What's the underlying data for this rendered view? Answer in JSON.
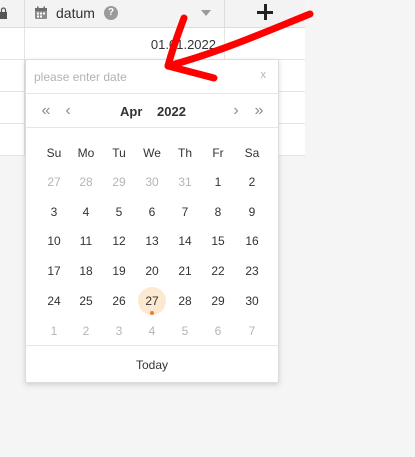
{
  "header": {
    "column_title": "datum",
    "help_glyph": "?",
    "icons": [
      "lock-icon",
      "calendar-icon",
      "help-icon",
      "dropdown-icon",
      "plus-icon"
    ]
  },
  "rows": [
    {
      "value": "01.01.2022"
    },
    {
      "value": ""
    },
    {
      "value": ""
    }
  ],
  "datepicker": {
    "placeholder": "please enter date",
    "value": "",
    "clear_label": "x",
    "nav": {
      "prev_year": "«",
      "prev_month": "‹",
      "next_month": "›",
      "next_year": "»"
    },
    "month": "Apr",
    "year": "2022",
    "weekdays": [
      "Su",
      "Mo",
      "Tu",
      "We",
      "Th",
      "Fr",
      "Sa"
    ],
    "weeks": [
      [
        {
          "d": "27",
          "m": true
        },
        {
          "d": "28",
          "m": true
        },
        {
          "d": "29",
          "m": true
        },
        {
          "d": "30",
          "m": true
        },
        {
          "d": "31",
          "m": true
        },
        {
          "d": "1"
        },
        {
          "d": "2"
        }
      ],
      [
        {
          "d": "3"
        },
        {
          "d": "4"
        },
        {
          "d": "5"
        },
        {
          "d": "6"
        },
        {
          "d": "7"
        },
        {
          "d": "8"
        },
        {
          "d": "9"
        }
      ],
      [
        {
          "d": "10"
        },
        {
          "d": "11"
        },
        {
          "d": "12"
        },
        {
          "d": "13"
        },
        {
          "d": "14"
        },
        {
          "d": "15"
        },
        {
          "d": "16"
        }
      ],
      [
        {
          "d": "17"
        },
        {
          "d": "18"
        },
        {
          "d": "19"
        },
        {
          "d": "20"
        },
        {
          "d": "21"
        },
        {
          "d": "22"
        },
        {
          "d": "23"
        }
      ],
      [
        {
          "d": "24"
        },
        {
          "d": "25"
        },
        {
          "d": "26"
        },
        {
          "d": "27",
          "today": true
        },
        {
          "d": "28"
        },
        {
          "d": "29"
        },
        {
          "d": "30"
        }
      ],
      [
        {
          "d": "1",
          "m": true
        },
        {
          "d": "2",
          "m": true
        },
        {
          "d": "3",
          "m": true
        },
        {
          "d": "4",
          "m": true
        },
        {
          "d": "5",
          "m": true
        },
        {
          "d": "6",
          "m": true
        },
        {
          "d": "7",
          "m": true
        }
      ]
    ],
    "today_label": "Today"
  },
  "colors": {
    "today_highlight": "#fde8d2",
    "today_dot": "#e8832a",
    "annotation_arrow": "#ff0000"
  }
}
